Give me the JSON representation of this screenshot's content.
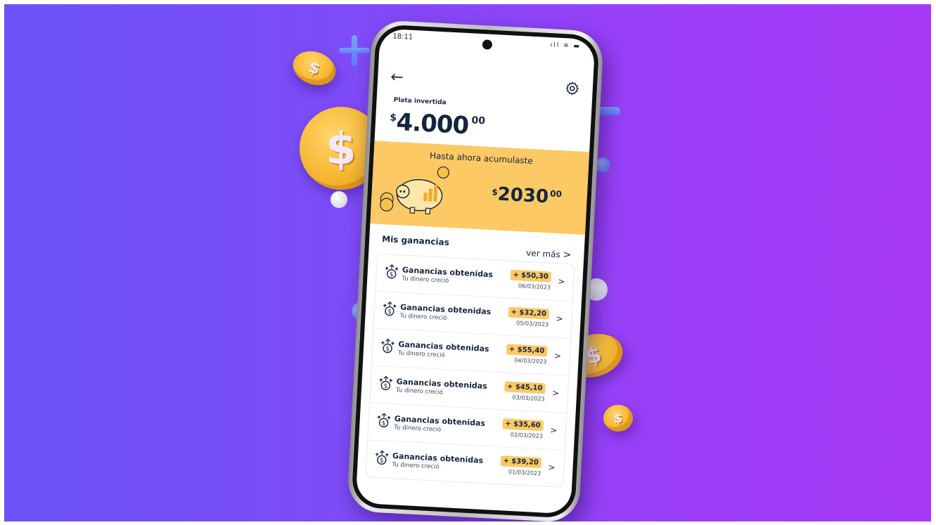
{
  "status": {
    "time": "18:11",
    "icons": "ıll ≋ ▬"
  },
  "header": {
    "back_icon": "arrow-left-icon",
    "settings_icon": "gear-icon"
  },
  "investment": {
    "label": "Plata invertida",
    "currency": "$",
    "amount": "4.000",
    "decimals": "00"
  },
  "accumulated": {
    "title": "Hasta ahora acumulaste",
    "currency": "$",
    "amount": "2030",
    "decimals": "00"
  },
  "earnings": {
    "title": "Mis ganancias",
    "see_more": "ver más",
    "items": [
      {
        "title": "Ganancias obtenidas",
        "subtitle": "Tu dinero creció",
        "amount": "+ $50,30",
        "date": "06/03/2023"
      },
      {
        "title": "Ganancias obtenidas",
        "subtitle": "Tu dinero creció",
        "amount": "+ $32,20",
        "date": "05/03/2023"
      },
      {
        "title": "Ganancias obtenidas",
        "subtitle": "Tu dinero creció",
        "amount": "+ $55,40",
        "date": "04/03/2023"
      },
      {
        "title": "Ganancias obtenidas",
        "subtitle": "Tu dinero creció",
        "amount": "+ $45,10",
        "date": "03/03/2023"
      },
      {
        "title": "Ganancias obtenidas",
        "subtitle": "Tu dinero creció",
        "amount": "+ $35,60",
        "date": "02/03/2023"
      },
      {
        "title": "Ganancias obtenidas",
        "subtitle": "Tu dinero creció",
        "amount": "+ $39,20",
        "date": "01/03/2023"
      }
    ]
  },
  "colors": {
    "accent": "#fcc965",
    "text": "#15253f",
    "background_from": "#6b54f6",
    "background_to": "#a83af7"
  }
}
